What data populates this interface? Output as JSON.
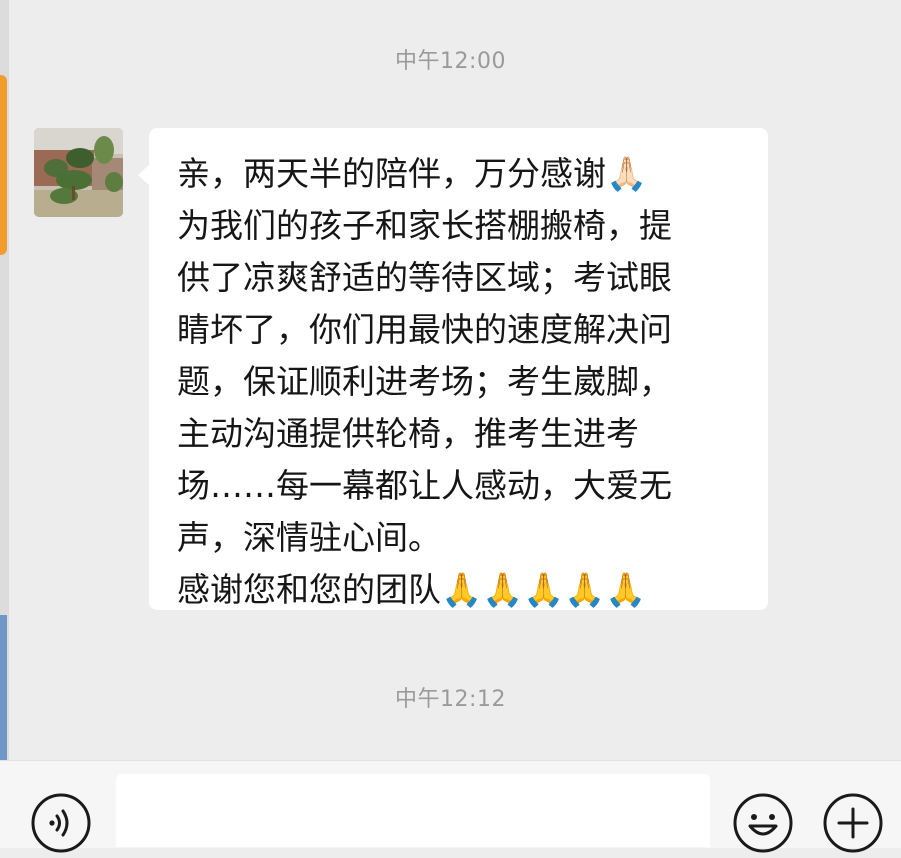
{
  "chat": {
    "timestamps": [
      "中午12:00",
      "中午12:12"
    ],
    "message": {
      "lines": [
        "亲，两天半的陪伴，万分感谢🙏🏻",
        "为我们的孩子和家长搭棚搬椅，提",
        "供了凉爽舒适的等待区域；考试眼",
        "睛坏了，你们用最快的速度解决问",
        "题，保证顺利进考场；考生崴脚，",
        "主动沟通提供轮椅，推考生进考",
        "场……每一幕都让人感动，大爱无",
        "声，深情驻心间。",
        "感谢您和您的团队🙏🙏🙏🙏🙏"
      ]
    }
  },
  "input_bar": {
    "text_value": "",
    "voice_icon": "voice-icon",
    "emoji_icon": "emoji-icon",
    "plus_icon": "plus-icon"
  },
  "colors": {
    "background": "#ededed",
    "bubble": "#ffffff",
    "timestamp": "#9a9a9a"
  }
}
